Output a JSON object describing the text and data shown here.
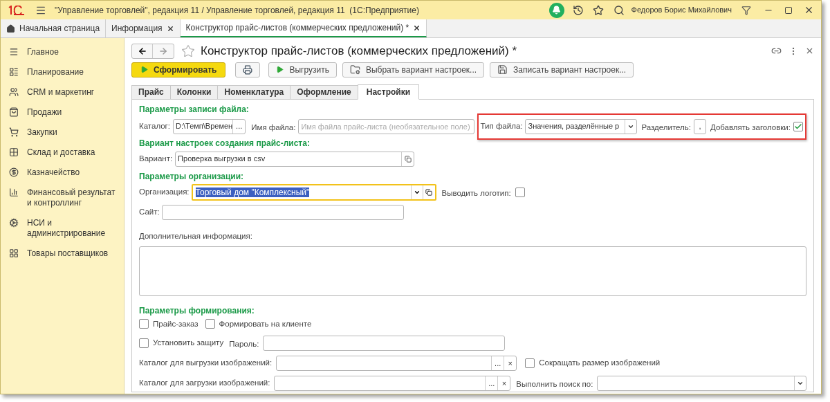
{
  "window": {
    "title": "\"Управление торговлей\", редакция 11 / Управление торговлей, редакция 11  (1С:Предприятие)",
    "user": "Федоров Борис Михайлович"
  },
  "tabs": [
    {
      "label": "Начальная страница",
      "kind": "home",
      "closable": false,
      "selected": false
    },
    {
      "label": "Информация",
      "kind": "page",
      "closable": true,
      "selected": false
    },
    {
      "label": "Конструктор прайс-листов (коммерческих предложений) *",
      "kind": "page",
      "closable": true,
      "selected": true
    }
  ],
  "sidebar": {
    "items": [
      {
        "label": "Главное"
      },
      {
        "label": "Планирование"
      },
      {
        "label": "CRM и маркетинг"
      },
      {
        "label": "Продажи"
      },
      {
        "label": "Закупки"
      },
      {
        "label": "Склад и доставка"
      },
      {
        "label": "Казначейство"
      },
      {
        "label": "Финансовый результат и контроллинг"
      },
      {
        "label": "НСИ и администрирование"
      },
      {
        "label": "Товары поставщиков"
      }
    ]
  },
  "form": {
    "title": "Конструктор прайс-листов (коммерческих предложений) *",
    "toolbar": [
      {
        "label": "Сформировать",
        "kind": "primary"
      },
      {
        "kind": "print"
      },
      {
        "label": "Выгрузить",
        "kind": "play"
      },
      {
        "label": "Выбрать вариант настроек...",
        "kind": "load"
      },
      {
        "label": "Записать вариант настроек...",
        "kind": "save"
      }
    ],
    "tabs": [
      {
        "label": "Прайс",
        "selected": false
      },
      {
        "label": "Колонки",
        "selected": false
      },
      {
        "label": "Номенклатура",
        "selected": false
      },
      {
        "label": "Оформление",
        "selected": false
      },
      {
        "label": "Настройки",
        "selected": true
      }
    ],
    "file_section": {
      "heading": "Параметры записи файла:",
      "catalog_label": "Каталог:",
      "catalog_value": "D:\\Темп\\Времен",
      "catalog_button": "...",
      "filename_label": "Имя файла:",
      "filename_placeholder": "Имя файла прайс-листа (необязательное поле)",
      "filetype_label": "Тип файла:",
      "filetype_value": "Значения, разделённые р",
      "separator_label": "Разделитель:",
      "separator_value": ",",
      "headers_label": "Добавлять заголовки:",
      "headers_checked": true
    },
    "variant_section": {
      "heading": "Вариант настроек создания прайс-листа:",
      "label": "Вариант:",
      "value": "Проверка выгрузки в csv"
    },
    "org_section": {
      "heading": "Параметры организации:",
      "org_label": "Организация:",
      "org_value": "Торговый дом \"Комплексный\"",
      "org_focused": true,
      "logo_label": "Выводить логотип:",
      "logo_checked": false,
      "site_label": "Сайт:",
      "info_label": "Дополнительная информация:"
    },
    "gen_section": {
      "heading": "Параметры формирования:",
      "price_order": {
        "label": "Прайс-заказ",
        "checked": false
      },
      "client": {
        "label": "Формировать на клиенте",
        "checked": false
      },
      "protect": {
        "label": "Установить защиту",
        "checked": false
      },
      "password_label": "Пароль:",
      "export_label": "Каталог для выгрузки изображений:",
      "shrink": {
        "label": "Сокращать размер изображений",
        "checked": false
      },
      "import_label": "Каталог для загрузки изображений:",
      "search_label": "Выполнить поиск по:",
      "dots": "...",
      "clear": "×"
    }
  }
}
